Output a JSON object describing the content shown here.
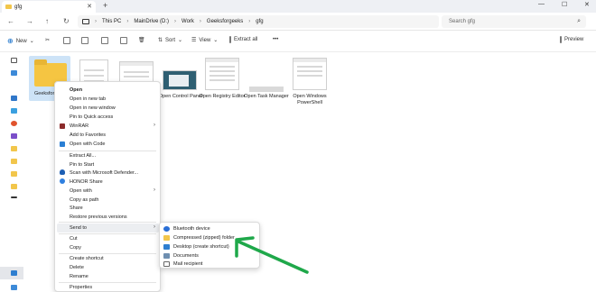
{
  "tab": {
    "title": "gfg",
    "close": "✕",
    "new": "+"
  },
  "window_controls": {
    "minimize": "—",
    "maximize": "☐",
    "close": "✕"
  },
  "nav": {
    "back": "←",
    "forward": "→",
    "up": "↑",
    "refresh": "↻"
  },
  "breadcrumb": [
    "This PC",
    "MainDrive (D:)",
    "Work",
    "Geeksforgeeks",
    "gfg"
  ],
  "search": {
    "placeholder": "Search gfg"
  },
  "toolbar": {
    "new": "New",
    "sort": "Sort",
    "view": "View",
    "extract_all": "Extract all",
    "more": "•••",
    "preview": "Preview"
  },
  "files": [
    {
      "name": "Geeksforg"
    },
    {
      "name": ""
    },
    {
      "name": ""
    },
    {
      "name": "Open Control Panel"
    },
    {
      "name": "Open Registry Editor"
    },
    {
      "name": "Open Task Manager"
    },
    {
      "name": "Open Windows PowerShell"
    }
  ],
  "context_menu": {
    "items": [
      {
        "label": "Open",
        "bold": true
      },
      {
        "label": "Open in new tab"
      },
      {
        "label": "Open in new window"
      },
      {
        "label": "Pin to Quick access"
      },
      {
        "label": "WinRAR",
        "submenu": true
      },
      {
        "label": "Add to Favorites"
      },
      {
        "label": "Open with Code"
      },
      {
        "label": "Extract All..."
      },
      {
        "label": "Pin to Start"
      },
      {
        "label": "Scan with Microsoft Defender..."
      },
      {
        "label": "HONOR Share"
      },
      {
        "label": "Open with",
        "submenu": true
      },
      {
        "label": "Copy as path"
      },
      {
        "label": "Share"
      },
      {
        "label": "Restore previous versions"
      },
      {
        "label": "Send to",
        "submenu": true
      },
      {
        "label": "Cut"
      },
      {
        "label": "Copy"
      },
      {
        "label": "Create shortcut"
      },
      {
        "label": "Delete"
      },
      {
        "label": "Rename"
      },
      {
        "label": "Properties"
      }
    ],
    "submenu_arrow": "›"
  },
  "send_to": {
    "items": [
      {
        "label": "Bluetooth device"
      },
      {
        "label": "Compressed (zipped) folder"
      },
      {
        "label": "Desktop (create shortcut)"
      },
      {
        "label": "Documents"
      },
      {
        "label": "Mail recipient"
      }
    ]
  },
  "colors": {
    "accent": "#0b69c7",
    "annotation_arrow": "#1fa84a",
    "folder": "#f5c542",
    "selection": "#cde3f7"
  }
}
